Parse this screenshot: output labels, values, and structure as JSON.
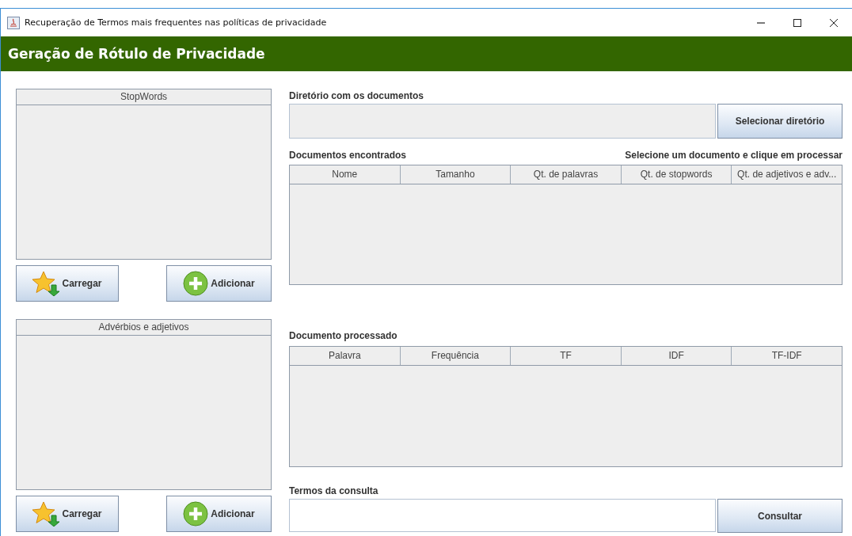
{
  "window": {
    "title": "Recuperação de Termos mais frequentes nas políticas de privacidade"
  },
  "header": {
    "title": "Geração de Rótulo de Privacidade"
  },
  "lists": [
    {
      "header": "StopWords",
      "buttons": [
        {
          "label": "Carregar",
          "kind": "load"
        },
        {
          "label": "Adicionar",
          "kind": "add"
        }
      ]
    },
    {
      "header": "Advérbios e adjetivos",
      "buttons": [
        {
          "label": "Carregar",
          "kind": "load"
        },
        {
          "label": "Adicionar",
          "kind": "add"
        }
      ]
    }
  ],
  "directory": {
    "label": "Diretório com os documentos",
    "button": "Selecionar diretório"
  },
  "documents": {
    "label": "Documentos encontrados",
    "hint": "Selecione um documento e clique em processar",
    "columns": [
      "Nome",
      "Tamanho",
      "Qt. de palavras",
      "Qt. de stopwords",
      "Qt. de adjetivos e adv..."
    ]
  },
  "processed": {
    "label": "Documento processado",
    "columns": [
      "Palavra",
      "Frequência",
      "TF",
      "IDF",
      "TF-IDF"
    ]
  },
  "query": {
    "label": "Termos da consulta",
    "button": "Consultar"
  }
}
